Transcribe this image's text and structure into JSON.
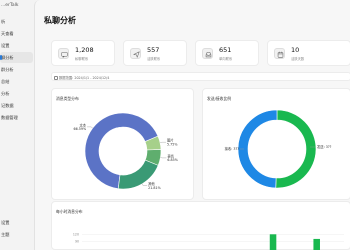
{
  "app": {
    "title": "...erTalk"
  },
  "window": {
    "minimize": "—",
    "maximize": "▢",
    "close": "✕"
  },
  "sidebar": {
    "items": [
      {
        "label": "析",
        "active": false
      },
      {
        "label": "天查看",
        "active": false
      },
      {
        "label": "设置",
        "active": false
      },
      {
        "label": "聊分析",
        "active": true
      },
      {
        "label": "群分析",
        "active": false
      },
      {
        "label": "总结",
        "active": false
      },
      {
        "label": "分析",
        "active": false
      },
      {
        "label": "记数据",
        "active": false
      },
      {
        "label": "数据管理",
        "active": false
      },
      {
        "label": "设置",
        "active": false
      },
      {
        "label": "主题",
        "active": false
      }
    ]
  },
  "page": {
    "title": "私聊分析"
  },
  "stats": [
    {
      "value": "1,208",
      "label": "私聊联系",
      "icon": "chat-icon"
    },
    {
      "value": "557",
      "label": "活跃联系",
      "icon": "send-icon"
    },
    {
      "value": "651",
      "label": "单向联系",
      "icon": "inbox-icon"
    },
    {
      "value": "10",
      "label": "活跃天数",
      "icon": "calendar-icon"
    }
  ],
  "range": {
    "text": "数据范围: 2024/1/1 - 2024/12/4"
  },
  "chart_data": [
    {
      "type": "pie",
      "title": "消息类型分布",
      "slices": [
        {
          "label": "文本",
          "percent_label": "66.59%",
          "value": 66.59,
          "color": "#5b73c6"
        },
        {
          "label": "图片",
          "percent_label": "5.75%",
          "value": 5.75,
          "color": "#a6d08a"
        },
        {
          "label": "表情",
          "percent_label": "6.85%",
          "value": 6.85,
          "color": "#5fae6e"
        },
        {
          "label": "其他",
          "percent_label": "21.81%",
          "value": 20.81,
          "color": "#3a9a75"
        }
      ]
    },
    {
      "type": "pie",
      "title": "发送/接收比例",
      "slices": [
        {
          "label": "发送: 3??",
          "value": 50.5,
          "color": "#19b84f"
        },
        {
          "label": "接收: 3??",
          "value": 49.5,
          "color": "#1e88e5"
        }
      ]
    },
    {
      "type": "bar",
      "title": "每小时消息分布",
      "y_ticks": [
        "120",
        "90"
      ],
      "bars": [
        {
          "hour": 17,
          "value": 120
        },
        {
          "hour": 21,
          "value": 100
        }
      ],
      "color": "#19b84f"
    }
  ]
}
